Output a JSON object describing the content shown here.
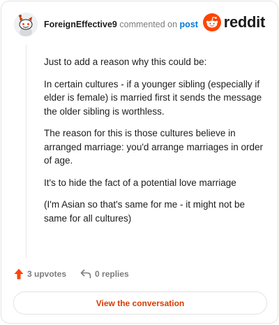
{
  "header": {
    "avatar_icon": "snoo-avatar-icon",
    "username": "ForeignEffective9",
    "action_text": "commented on",
    "post_link": "post",
    "brand_logo_text": "reddit",
    "brand_logo_icon": "reddit-alien-icon",
    "brand_color": "#ff4500"
  },
  "comment": {
    "paragraphs": [
      "Just to add a reason why this could be:",
      "In certain cultures - if a younger sibling (especially if elder is female) is married first it sends the message the older sibling is worthless.",
      "The reason for this is those cultures believe in arranged marriage: you'd arrange marriages in order of age.",
      "It's to hide the fact of a potential love marriage",
      "(I'm Asian so that's same for me - it might not be same for all cultures)"
    ]
  },
  "actions": {
    "upvote_icon": "upvote-arrow-icon",
    "upvotes_label": "3 upvotes",
    "reply_icon": "reply-arrow-icon",
    "replies_label": "0 replies"
  },
  "footer": {
    "view_button_label": "View the conversation",
    "accent_color": "#d93a00"
  }
}
